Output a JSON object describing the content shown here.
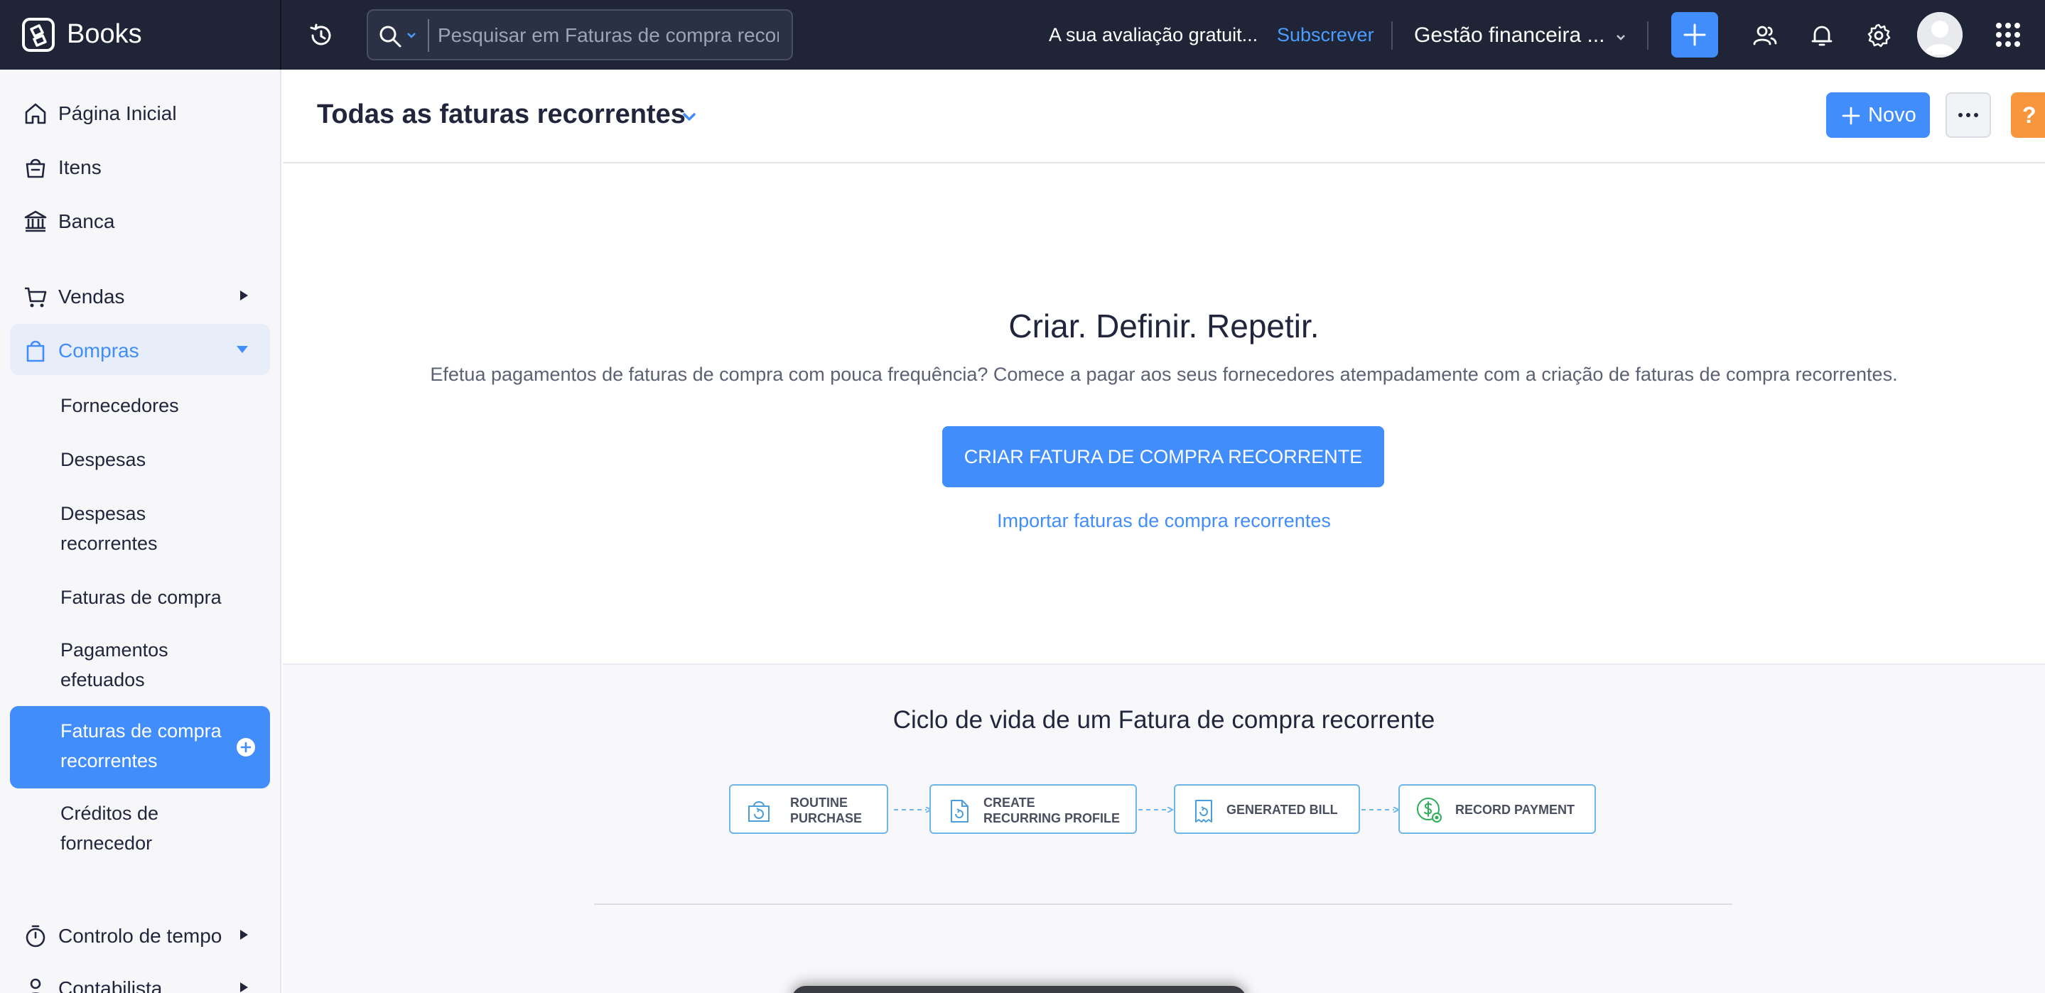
{
  "app": {
    "name": "Books"
  },
  "topbar": {
    "search_placeholder": "Pesquisar em Faturas de compra recorrentes",
    "trial_text": "A sua avaliação gratuit...",
    "subscribe_label": "Subscrever",
    "org_name": "Gestão financeira ...",
    "icons": [
      "history-icon",
      "search-icon",
      "plus-icon",
      "users-icon",
      "bell-icon",
      "gear-icon",
      "avatar",
      "apps-grid-icon"
    ]
  },
  "sidebar": {
    "items": [
      {
        "label": "Página Inicial",
        "icon": "home-icon"
      },
      {
        "label": "Itens",
        "icon": "basket-icon"
      },
      {
        "label": "Banca",
        "icon": "bank-icon"
      },
      {
        "label": "Vendas",
        "icon": "cart-icon"
      },
      {
        "label": "Compras",
        "icon": "bag-icon"
      },
      {
        "label": "Controlo de tempo",
        "icon": "stopwatch-icon"
      },
      {
        "label": "Contabilista",
        "icon": "person-icon"
      }
    ],
    "compras_sub": [
      {
        "label": "Fornecedores"
      },
      {
        "label": "Despesas"
      },
      {
        "label": "Despesas recorrentes"
      },
      {
        "label": "Faturas de compra"
      },
      {
        "label": "Pagamentos efetuados"
      },
      {
        "label": "Faturas de compra recorrentes"
      },
      {
        "label": "Créditos de fornecedor"
      }
    ]
  },
  "header": {
    "view_title": "Todas as faturas recorrentes",
    "new_label": "Novo",
    "help_label": "?"
  },
  "empty_state": {
    "title": "Criar. Definir. Repetir.",
    "description": "Efetua pagamentos de faturas de compra com pouca frequência? Comece a pagar aos seus fornecedores atempadamente com a criação de faturas de compra recorrentes.",
    "cta_label": "CRIAR FATURA DE COMPRA RECORRENTE",
    "import_label": "Importar faturas de compra recorrentes"
  },
  "lifecycle": {
    "title": "Ciclo de vida de um Fatura de compra recorrente",
    "steps": [
      {
        "label": "ROUTINE\nPURCHASE"
      },
      {
        "label": "CREATE\nRECURRING PROFILE"
      },
      {
        "label": "GENERATED BILL"
      },
      {
        "label": "RECORD PAYMENT"
      }
    ]
  },
  "colors": {
    "topbar_bg": "#1f2536",
    "accent_blue": "#408dfb",
    "subscribe_blue": "#4a9cff",
    "help_orange": "#f8963e",
    "sidebar_bg": "#f7f7fa",
    "lifecycle_border": "#6fb6ea",
    "payment_green": "#2fae5a"
  }
}
